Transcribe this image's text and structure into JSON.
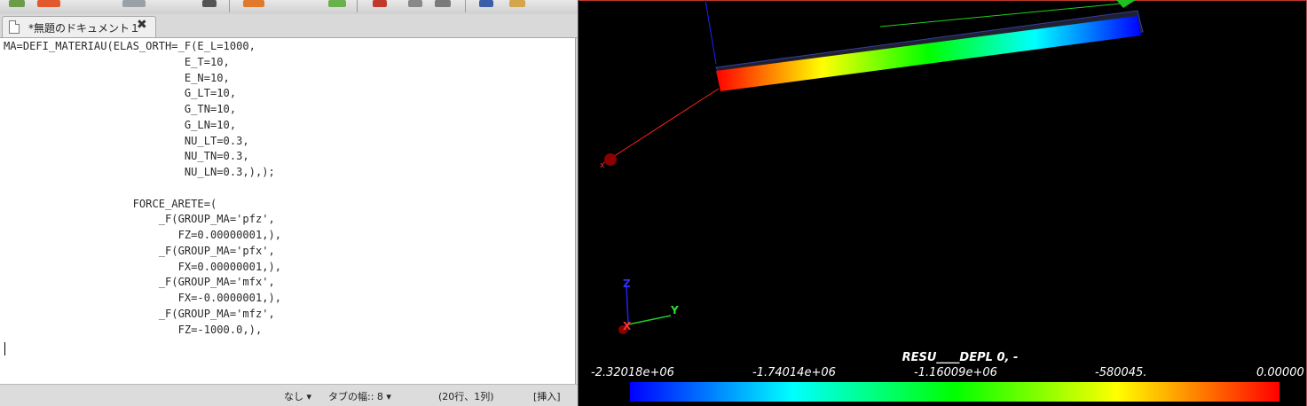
{
  "editor": {
    "tab_title": "*無題のドキュメント１",
    "close_icon": "✖",
    "code_lines": [
      "MA=DEFI_MATERIAU(ELAS_ORTH=_F(E_L=1000,",
      "                            E_T=10,",
      "                            E_N=10,",
      "                            G_LT=10,",
      "                            G_TN=10,",
      "                            G_LN=10,",
      "                            NU_LT=0.3,",
      "                            NU_TN=0.3,",
      "                            NU_LN=0.3,),);",
      "",
      "                    FORCE_ARETE=(",
      "                        _F(GROUP_MA='pfz',",
      "                           FZ=0.00000001,),",
      "                        _F(GROUP_MA='pfx',",
      "                           FX=0.00000001,),",
      "                        _F(GROUP_MA='mfx',",
      "                           FX=-0.0000001,),",
      "                        _F(GROUP_MA='mfz',",
      "                           FZ=-1000.0,),"
    ],
    "status": {
      "syntax": "なし ▾",
      "tab_width": "タブの幅:: 8 ▾",
      "position": "(20行、1列)",
      "mode": "[挿入]"
    }
  },
  "viewport": {
    "colorbar_title": "RESU____DEPL 0, -",
    "colorbar_ticks": [
      "-2.32018e+06",
      "-1.74014e+06",
      "-1.16009e+06",
      "-580045.",
      "0.00000"
    ],
    "axis_labels": {
      "x": "X",
      "y": "Y",
      "z": "Z"
    },
    "colors": {
      "beam_gradient": [
        "#ff0000",
        "#ffff00",
        "#00ff00",
        "#00ffff",
        "#0000ff"
      ],
      "colorbar_gradient": [
        "#0000ff",
        "#00ffff",
        "#00ff00",
        "#ffff00",
        "#ff0000"
      ],
      "axis_x": "#ff2020",
      "axis_y": "#20ff20",
      "axis_z": "#2020ff"
    }
  }
}
